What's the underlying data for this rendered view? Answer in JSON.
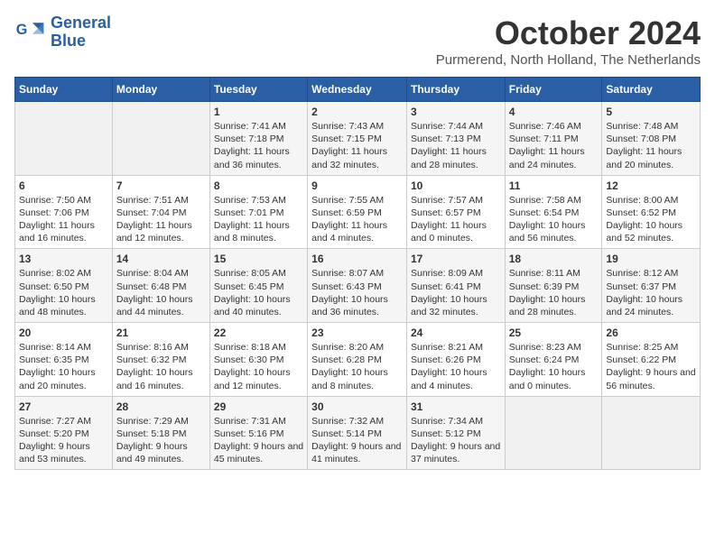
{
  "header": {
    "logo_line1": "General",
    "logo_line2": "Blue",
    "month": "October 2024",
    "location": "Purmerend, North Holland, The Netherlands"
  },
  "days_of_week": [
    "Sunday",
    "Monday",
    "Tuesday",
    "Wednesday",
    "Thursday",
    "Friday",
    "Saturday"
  ],
  "weeks": [
    [
      {
        "day": "",
        "content": ""
      },
      {
        "day": "",
        "content": ""
      },
      {
        "day": "1",
        "content": "Sunrise: 7:41 AM\nSunset: 7:18 PM\nDaylight: 11 hours and 36 minutes."
      },
      {
        "day": "2",
        "content": "Sunrise: 7:43 AM\nSunset: 7:15 PM\nDaylight: 11 hours and 32 minutes."
      },
      {
        "day": "3",
        "content": "Sunrise: 7:44 AM\nSunset: 7:13 PM\nDaylight: 11 hours and 28 minutes."
      },
      {
        "day": "4",
        "content": "Sunrise: 7:46 AM\nSunset: 7:11 PM\nDaylight: 11 hours and 24 minutes."
      },
      {
        "day": "5",
        "content": "Sunrise: 7:48 AM\nSunset: 7:08 PM\nDaylight: 11 hours and 20 minutes."
      }
    ],
    [
      {
        "day": "6",
        "content": "Sunrise: 7:50 AM\nSunset: 7:06 PM\nDaylight: 11 hours and 16 minutes."
      },
      {
        "day": "7",
        "content": "Sunrise: 7:51 AM\nSunset: 7:04 PM\nDaylight: 11 hours and 12 minutes."
      },
      {
        "day": "8",
        "content": "Sunrise: 7:53 AM\nSunset: 7:01 PM\nDaylight: 11 hours and 8 minutes."
      },
      {
        "day": "9",
        "content": "Sunrise: 7:55 AM\nSunset: 6:59 PM\nDaylight: 11 hours and 4 minutes."
      },
      {
        "day": "10",
        "content": "Sunrise: 7:57 AM\nSunset: 6:57 PM\nDaylight: 11 hours and 0 minutes."
      },
      {
        "day": "11",
        "content": "Sunrise: 7:58 AM\nSunset: 6:54 PM\nDaylight: 10 hours and 56 minutes."
      },
      {
        "day": "12",
        "content": "Sunrise: 8:00 AM\nSunset: 6:52 PM\nDaylight: 10 hours and 52 minutes."
      }
    ],
    [
      {
        "day": "13",
        "content": "Sunrise: 8:02 AM\nSunset: 6:50 PM\nDaylight: 10 hours and 48 minutes."
      },
      {
        "day": "14",
        "content": "Sunrise: 8:04 AM\nSunset: 6:48 PM\nDaylight: 10 hours and 44 minutes."
      },
      {
        "day": "15",
        "content": "Sunrise: 8:05 AM\nSunset: 6:45 PM\nDaylight: 10 hours and 40 minutes."
      },
      {
        "day": "16",
        "content": "Sunrise: 8:07 AM\nSunset: 6:43 PM\nDaylight: 10 hours and 36 minutes."
      },
      {
        "day": "17",
        "content": "Sunrise: 8:09 AM\nSunset: 6:41 PM\nDaylight: 10 hours and 32 minutes."
      },
      {
        "day": "18",
        "content": "Sunrise: 8:11 AM\nSunset: 6:39 PM\nDaylight: 10 hours and 28 minutes."
      },
      {
        "day": "19",
        "content": "Sunrise: 8:12 AM\nSunset: 6:37 PM\nDaylight: 10 hours and 24 minutes."
      }
    ],
    [
      {
        "day": "20",
        "content": "Sunrise: 8:14 AM\nSunset: 6:35 PM\nDaylight: 10 hours and 20 minutes."
      },
      {
        "day": "21",
        "content": "Sunrise: 8:16 AM\nSunset: 6:32 PM\nDaylight: 10 hours and 16 minutes."
      },
      {
        "day": "22",
        "content": "Sunrise: 8:18 AM\nSunset: 6:30 PM\nDaylight: 10 hours and 12 minutes."
      },
      {
        "day": "23",
        "content": "Sunrise: 8:20 AM\nSunset: 6:28 PM\nDaylight: 10 hours and 8 minutes."
      },
      {
        "day": "24",
        "content": "Sunrise: 8:21 AM\nSunset: 6:26 PM\nDaylight: 10 hours and 4 minutes."
      },
      {
        "day": "25",
        "content": "Sunrise: 8:23 AM\nSunset: 6:24 PM\nDaylight: 10 hours and 0 minutes."
      },
      {
        "day": "26",
        "content": "Sunrise: 8:25 AM\nSunset: 6:22 PM\nDaylight: 9 hours and 56 minutes."
      }
    ],
    [
      {
        "day": "27",
        "content": "Sunrise: 7:27 AM\nSunset: 5:20 PM\nDaylight: 9 hours and 53 minutes."
      },
      {
        "day": "28",
        "content": "Sunrise: 7:29 AM\nSunset: 5:18 PM\nDaylight: 9 hours and 49 minutes."
      },
      {
        "day": "29",
        "content": "Sunrise: 7:31 AM\nSunset: 5:16 PM\nDaylight: 9 hours and 45 minutes."
      },
      {
        "day": "30",
        "content": "Sunrise: 7:32 AM\nSunset: 5:14 PM\nDaylight: 9 hours and 41 minutes."
      },
      {
        "day": "31",
        "content": "Sunrise: 7:34 AM\nSunset: 5:12 PM\nDaylight: 9 hours and 37 minutes."
      },
      {
        "day": "",
        "content": ""
      },
      {
        "day": "",
        "content": ""
      }
    ]
  ]
}
